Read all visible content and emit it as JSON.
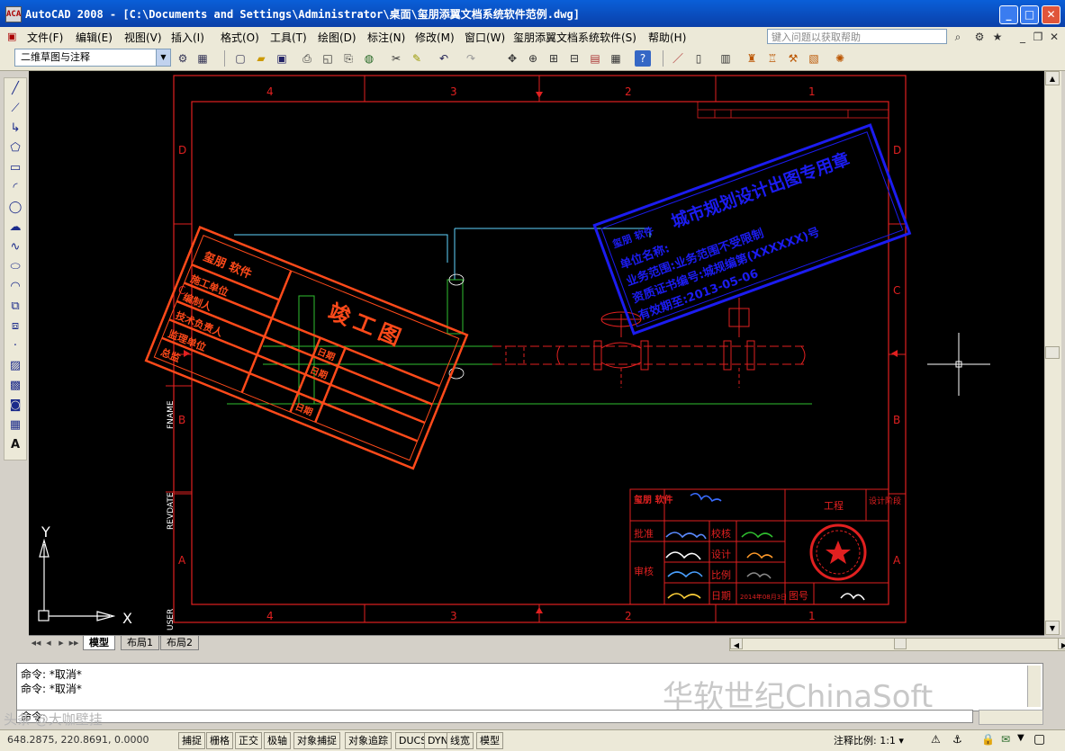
{
  "window": {
    "title": "AutoCAD 2008 - [C:\\Documents and Settings\\Administrator\\桌面\\玺朋添翼文档系统软件范例.dwg]",
    "app_icon": "ACA",
    "minimize": "_",
    "maximize": "□",
    "close": "✕"
  },
  "menu": {
    "items": [
      "文件(F)",
      "编辑(E)",
      "视图(V)",
      "插入(I)",
      "格式(O)",
      "工具(T)",
      "绘图(D)",
      "标注(N)",
      "修改(M)",
      "窗口(W)",
      "玺朋添翼文档系统软件(S)",
      "帮助(H)"
    ],
    "help_placeholder": "键入问题以获取帮助"
  },
  "toolbar": {
    "workspace": "二维草图与注释"
  },
  "drawing": {
    "zones_top": [
      "4",
      "3",
      "2",
      "1"
    ],
    "zones_bottom": [
      "4",
      "3",
      "2",
      "1"
    ],
    "rows_left": [
      "D",
      "C",
      "B",
      "A"
    ],
    "rows_right": [
      "D",
      "C",
      "B",
      "A"
    ],
    "side_labels": [
      "FNAME",
      "REVDATE",
      "USER"
    ],
    "ucs_y": "Y",
    "ucs_x": "X",
    "red_stamp": {
      "logo": "玺朋 软件",
      "title": "竣工图",
      "rows": [
        "施工单位",
        "编制人",
        "技术负责人",
        "监理单位",
        "总监"
      ],
      "date_labels": [
        "日期",
        "日期",
        "日期"
      ]
    },
    "blue_stamp": {
      "logo": "玺朋 软件",
      "title": "城市规划设计出图专用章",
      "lines": [
        "单位名称:",
        "业务范围:业务范围不受限制",
        "资质证书编号:城规编第(XXXXXX)号",
        "有效期至:2013-05-06"
      ]
    },
    "titleblock": {
      "logo": "玺朋 软件",
      "project": "工程",
      "design_stage": "设计阶段",
      "labels": [
        "批准",
        "审核",
        "校核",
        "设计",
        "比例",
        "日期",
        "图号"
      ],
      "date_value": "2014年08月3日"
    }
  },
  "tabs": [
    "模型",
    "布局1",
    "布局2"
  ],
  "command": {
    "history": [
      "命令: *取消*",
      "命令: *取消*"
    ],
    "prompt": "命令:"
  },
  "watermark": "华软世纪ChinaSoft",
  "watermark2": "头条 @大咖壁挂",
  "status": {
    "coords": "648.2875, 220.8691, 0.0000",
    "toggles": [
      "捕捉",
      "栅格",
      "正交",
      "极轴",
      "对象捕捉",
      "对象追踪",
      "DUCS",
      "DYN",
      "线宽",
      "模型"
    ],
    "annotation_scale": "注释比例: 1:1 ▾"
  }
}
